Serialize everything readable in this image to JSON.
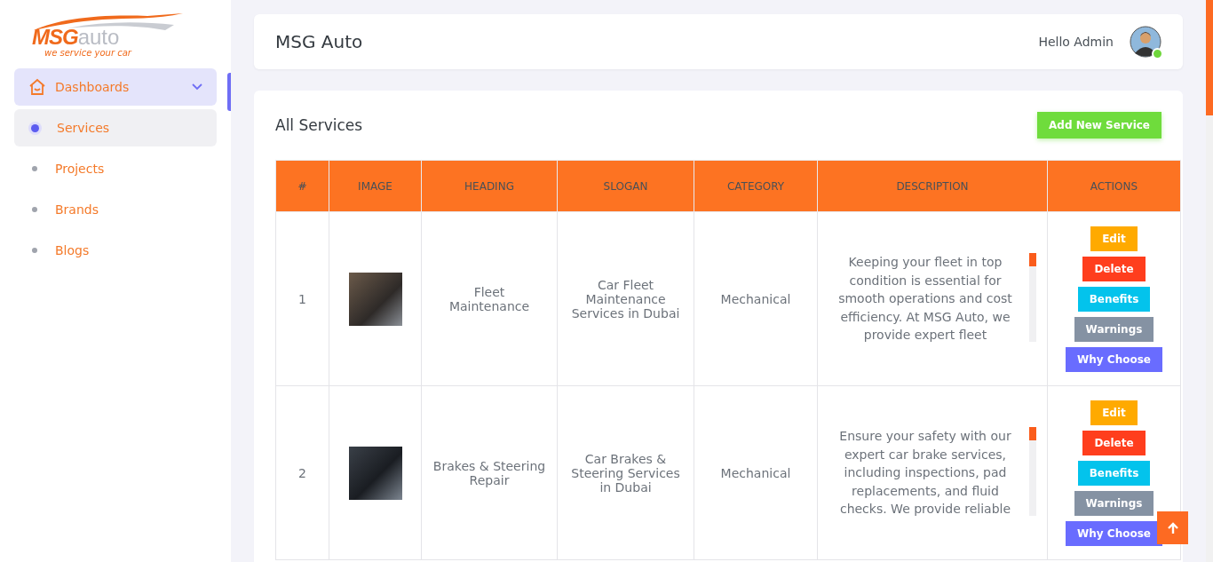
{
  "logo": {
    "brand_bold": "MSG",
    "brand_light": "auto",
    "tagline": "we service your car"
  },
  "sidebar": {
    "group": {
      "label": "Dashboards",
      "expanded": true
    },
    "items": [
      {
        "label": "Services",
        "selected": true
      },
      {
        "label": "Projects",
        "selected": false
      },
      {
        "label": "Brands",
        "selected": false
      },
      {
        "label": "Blogs",
        "selected": false
      }
    ]
  },
  "header": {
    "title": "MSG Auto",
    "greeting": "Hello Admin",
    "online": true
  },
  "card": {
    "title": "All Services",
    "add_button": "Add New Service"
  },
  "table": {
    "columns": [
      "#",
      "IMAGE",
      "HEADING",
      "SLOGAN",
      "CATEGORY",
      "DESCRIPTION",
      "ACTIONS"
    ],
    "rows": [
      {
        "number": "1",
        "heading": "Fleet Maintenance",
        "slogan": "Car Fleet Maintenance Services in Dubai",
        "category": "Mechanical",
        "description": "Keeping your fleet in top condition is essential for smooth operations and cost efficiency. At MSG Auto, we provide expert fleet",
        "actions": [
          {
            "label": "Edit",
            "kind": "edit"
          },
          {
            "label": "Delete",
            "kind": "delete"
          },
          {
            "label": "Benefits",
            "kind": "benefits"
          },
          {
            "label": "Warnings",
            "kind": "warnings"
          },
          {
            "label": "Why Choose",
            "kind": "why"
          }
        ]
      },
      {
        "number": "2",
        "heading": "Brakes & Steering Repair",
        "slogan": "Car Brakes & Steering Services in Dubai",
        "category": "Mechanical",
        "description": "Ensure your safety with our expert car brake services, including inspections, pad replacements, and fluid checks. We provide reliable",
        "actions": [
          {
            "label": "Edit",
            "kind": "edit"
          },
          {
            "label": "Delete",
            "kind": "delete"
          },
          {
            "label": "Benefits",
            "kind": "benefits"
          },
          {
            "label": "Warnings",
            "kind": "warnings"
          },
          {
            "label": "Why Choose",
            "kind": "why"
          }
        ]
      }
    ]
  }
}
